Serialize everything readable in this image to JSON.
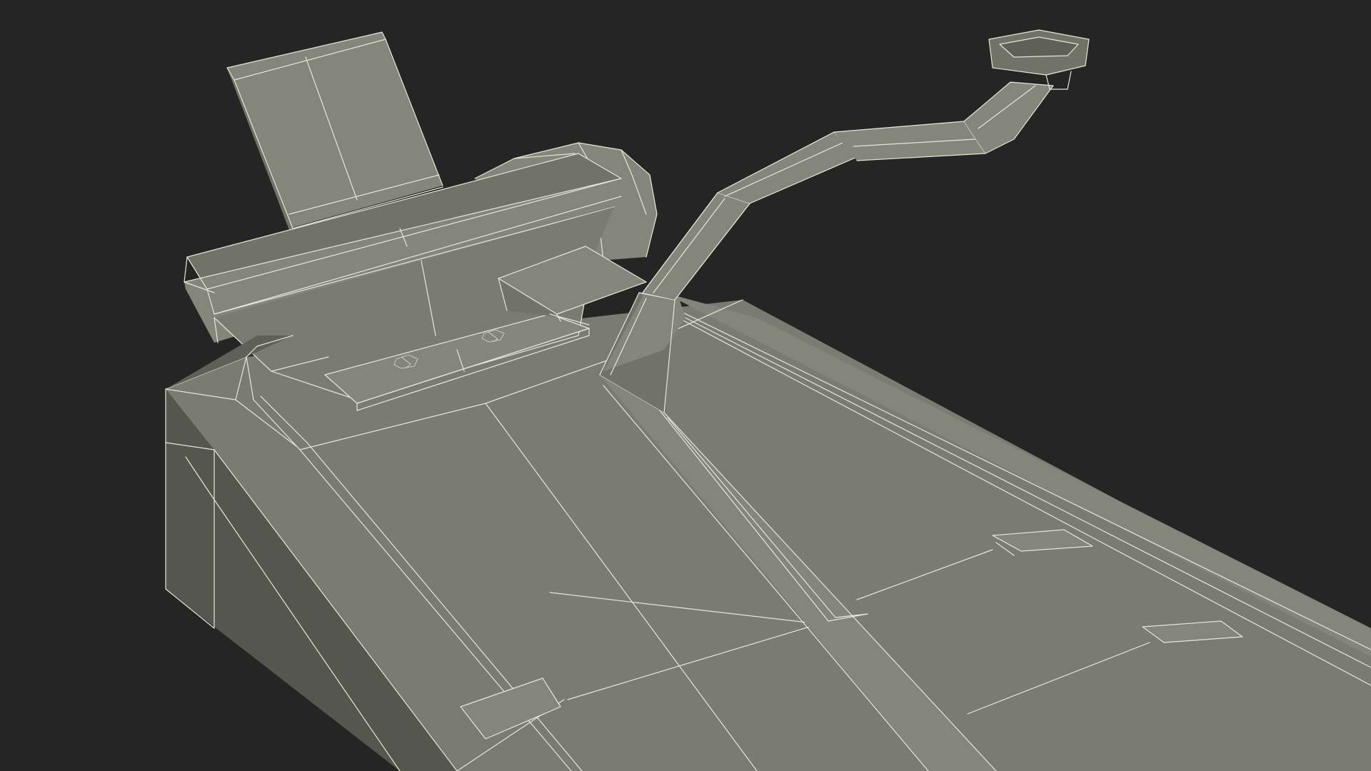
{
  "scene": {
    "background_color": "#252525",
    "surface_color": "#7b7c71",
    "wire_color": "#e6e6d8"
  }
}
